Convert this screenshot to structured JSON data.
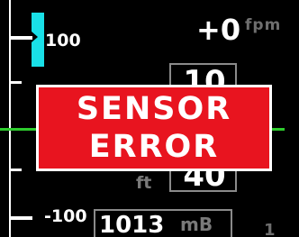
{
  "vertical_speed": {
    "scale_top_label": "100",
    "scale_bottom_label": "-100",
    "value": "+0",
    "unit": "fpm"
  },
  "altimeter": {
    "digits_top": "10",
    "digits_bottom": "40",
    "unit": "ft"
  },
  "sensor_error": {
    "line1": "SENSOR",
    "line2": "ERROR"
  },
  "baro": {
    "value": "1013",
    "unit": "mB"
  },
  "corner_digit": "1",
  "colors": {
    "background": "#000000",
    "error_red": "#e8141f",
    "bug_cyan": "#19e0e8",
    "reference_green": "#2ecc2e",
    "unit_gray": "#7a7a7a"
  },
  "icons": {
    "vs_bug": "vertical-speed-bug-icon"
  }
}
